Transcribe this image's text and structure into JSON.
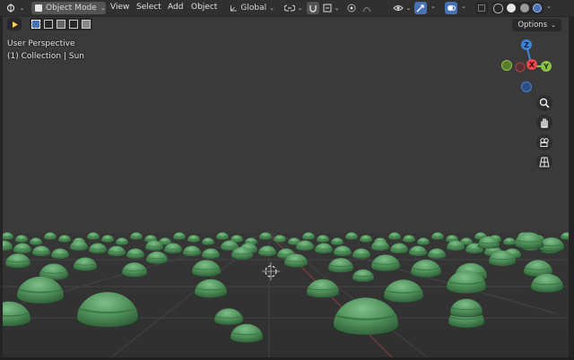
{
  "header": {
    "editor_type_icon": "editor-type-icon",
    "mode_label": "Object Mode",
    "menus": [
      "View",
      "Select",
      "Add",
      "Object"
    ],
    "orientation_label": "Global",
    "mode_icon": "object-mode-icon"
  },
  "overlay": {
    "view_name": "User Perspective",
    "collection_info": "(1) Collection | Sun"
  },
  "options_label": "Options",
  "gizmo": {
    "z_label": "Z",
    "y_label": "Y",
    "x_label": "X",
    "colors": {
      "x": "#e8474e",
      "y": "#8bc34a",
      "z": "#3d84d8"
    }
  },
  "nav_icons": [
    "zoom-icon",
    "hand-pan-icon",
    "camera-view-icon",
    "grid-view-icon"
  ],
  "scene": {
    "background": "#3a3a3a",
    "floor": "#343434",
    "object_color": "#4a8a55"
  }
}
